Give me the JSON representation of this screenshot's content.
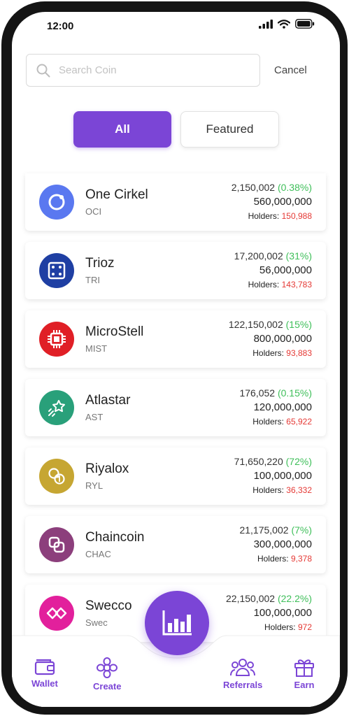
{
  "status_bar": {
    "time": "12:00"
  },
  "search": {
    "placeholder": "Search Coin",
    "value": "",
    "cancel_label": "Cancel"
  },
  "tabs": [
    {
      "label": "All",
      "active": true
    },
    {
      "label": "Featured",
      "active": false
    }
  ],
  "coins": [
    {
      "name": "One Cirkel",
      "symbol": "OCI",
      "price": "2,150,002",
      "change": "(0.38%)",
      "supply": "560,000,000",
      "holders_label": "Holders:",
      "holders": "150,988",
      "color": "#5a78f0",
      "icon": "ring-icon"
    },
    {
      "name": "Trioz",
      "symbol": "TRI",
      "price": "17,200,002",
      "change": "(31%)",
      "supply": "56,000,000",
      "holders_label": "Holders:",
      "holders": "143,783",
      "color": "#1f3fa3",
      "icon": "dice-icon"
    },
    {
      "name": "MicroStell",
      "symbol": "MIST",
      "price": "122,150,002",
      "change": "(15%)",
      "supply": "800,000,000",
      "holders_label": "Holders:",
      "holders": "93,883",
      "color": "#e01f26",
      "icon": "chip-icon"
    },
    {
      "name": "Atlastar",
      "symbol": "AST",
      "price": "176,052",
      "change": "(0.15%)",
      "supply": "120,000,000",
      "holders_label": "Holders:",
      "holders": "65,922",
      "color": "#29a07a",
      "icon": "shooting-star-icon"
    },
    {
      "name": "Riyalox",
      "symbol": "RYL",
      "price": "71,650,220",
      "change": "(72%)",
      "supply": "100,000,000",
      "holders_label": "Holders:",
      "holders": "36,332",
      "color": "#c6a632",
      "icon": "coins-icon"
    },
    {
      "name": "Chaincoin",
      "symbol": "CHAC",
      "price": "21,175,002",
      "change": "(7%)",
      "supply": "300,000,000",
      "holders_label": "Holders:",
      "holders": "9,378",
      "color": "#8c3f7c",
      "icon": "chain-icon"
    },
    {
      "name": "Swecco",
      "symbol": "Swec",
      "price": "22,150,002",
      "change": "(22.2%)",
      "supply": "100,000,000",
      "holders_label": "Holders:",
      "holders": "972",
      "color": "#e2209c",
      "icon": "diamond-link-icon"
    }
  ],
  "bottom_nav": {
    "items": [
      {
        "label": "Wallet",
        "icon": "wallet-icon"
      },
      {
        "label": "Create",
        "icon": "flower-icon"
      },
      {
        "label": "Referrals",
        "icon": "group-icon"
      },
      {
        "label": "Earn",
        "icon": "gift-icon"
      }
    ],
    "fab_icon": "bar-chart-icon"
  },
  "colors": {
    "accent": "#7b45d6",
    "positive": "#3fbf5a",
    "negative": "#e53935"
  }
}
